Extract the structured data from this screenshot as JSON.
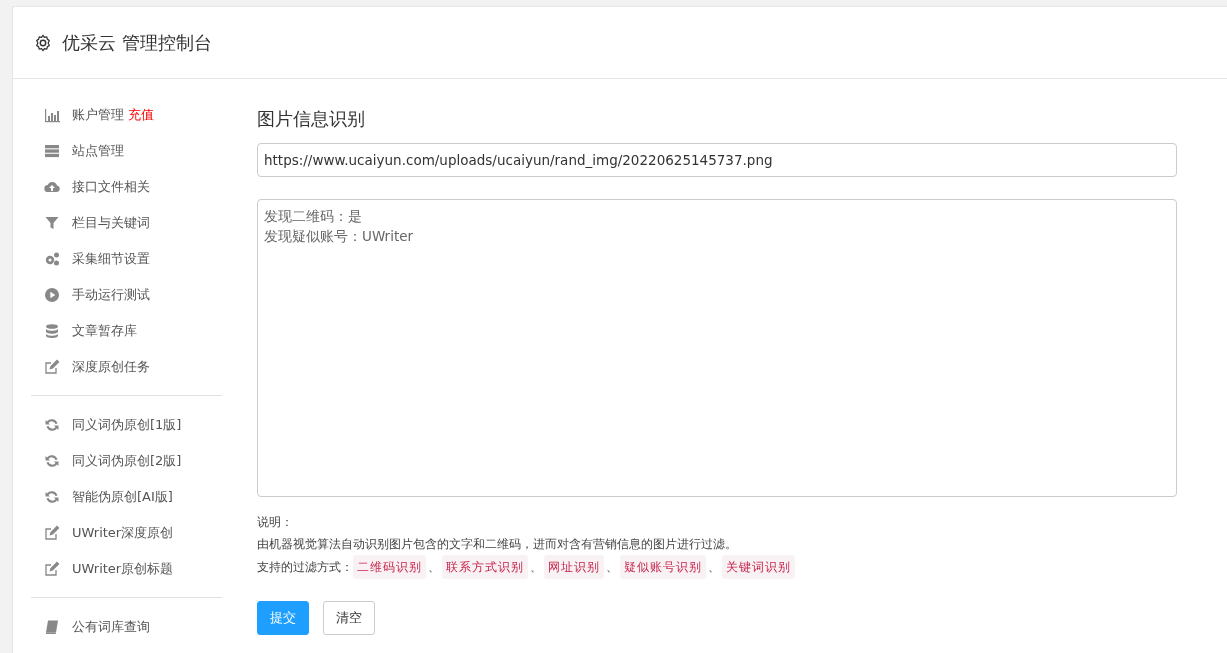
{
  "header": {
    "title": "优采云 管理控制台"
  },
  "sidebar": {
    "groups": [
      {
        "items": [
          {
            "kind": "chart",
            "label": "账户管理",
            "badge": "充值"
          },
          {
            "kind": "server",
            "label": "站点管理"
          },
          {
            "kind": "cloud",
            "label": "接口文件相关"
          },
          {
            "kind": "filter",
            "label": "栏目与关键词"
          },
          {
            "kind": "gears",
            "label": "采集细节设置"
          },
          {
            "kind": "play",
            "label": "手动运行测试"
          },
          {
            "kind": "database",
            "label": "文章暂存库"
          },
          {
            "kind": "edit",
            "label": "深度原创任务"
          }
        ]
      },
      {
        "items": [
          {
            "kind": "refresh",
            "label": "同义词伪原创[1版]"
          },
          {
            "kind": "refresh",
            "label": "同义词伪原创[2版]"
          },
          {
            "kind": "refresh",
            "label": "智能伪原创[AI版]"
          },
          {
            "kind": "edit",
            "label": "UWriter深度原创"
          },
          {
            "kind": "edit",
            "label": "UWriter原创标题"
          }
        ]
      },
      {
        "items": [
          {
            "kind": "book",
            "label": "公有词库查询"
          }
        ]
      }
    ]
  },
  "main": {
    "heading": "图片信息识别",
    "url_field": {
      "value": "https://www.ucaiyun.com/uploads/ucaiyun/rand_img/20220625145737.png"
    },
    "result_box": {
      "lines": [
        "发现二维码：是",
        "发现疑似账号：UWriter"
      ]
    },
    "notes_label": "说明：",
    "notes_text": "由机器视觉算法自动识别图片包含的文字和二维码，进而对含有营销信息的图片进行过滤。",
    "filters_label": "支持的过滤方式：",
    "filter_separator": "、",
    "filters": [
      "二维码识别",
      "联系方式识别",
      "网址识别",
      "疑似账号识别",
      "关键词识别"
    ],
    "buttons": [
      {
        "kind": "primary",
        "label": "提交"
      },
      {
        "kind": "default",
        "label": "清空"
      }
    ]
  }
}
